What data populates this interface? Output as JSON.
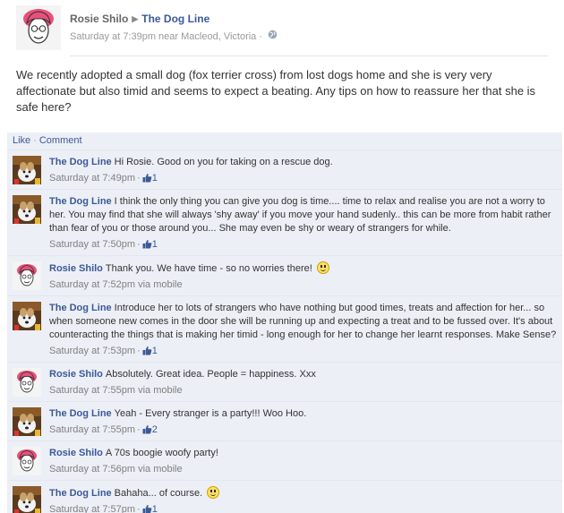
{
  "post": {
    "author": "Rosie Shilo",
    "target_page": "The Dog Line",
    "timestamp": "Saturday at 7:39pm near Macleod, Victoria",
    "privacy_icon": "globe-icon",
    "body": "We recently adopted a small dog (fox terrier cross) from lost dogs home and she is very very affectionate but also timid and seems to expect a beating. Any tips on how to reassure her that she is safe here?"
  },
  "actions": {
    "like": "Like",
    "separator": "·",
    "comment": "Comment"
  },
  "comments": [
    {
      "author": "The Dog Line",
      "type": "page",
      "text": "Hi Rosie. Good on you for taking on a rescue dog.",
      "time": "Saturday at 7:49pm",
      "via": "",
      "likes": "1",
      "emoticon": false
    },
    {
      "author": "The Dog Line",
      "type": "page",
      "text": "I think the only thing you can give you dog is time.... time to relax and realise you are not a worry to her. You may find that she will always 'shy away' if you move your hand sudenly.. this can be more from habit rather than fear of you or those around you... She may even be shy or weary of strangers for while.",
      "time": "Saturday at 7:50pm",
      "via": "",
      "likes": "1",
      "emoticon": false
    },
    {
      "author": "Rosie Shilo",
      "type": "user",
      "text": "Thank you. We have time - so no worries there!",
      "time": "Saturday at 7:52pm",
      "via": "via mobile",
      "likes": "",
      "emoticon": true
    },
    {
      "author": "The Dog Line",
      "type": "page",
      "text": "Introduce her to lots of strangers who have nothing but good times, treats and affection for her... so when someone new comes in the door she will be running up and expecting a treat and to be fussed over. It's about counteracting the things that is making her timid - long enough for her to change her learnt responses. Make Sense?",
      "time": "Saturday at 7:53pm",
      "via": "",
      "likes": "1",
      "emoticon": false
    },
    {
      "author": "Rosie Shilo",
      "type": "user",
      "text": "Absolutely. Great idea. People = happiness. Xxx",
      "time": "Saturday at 7:55pm",
      "via": "via mobile",
      "likes": "",
      "emoticon": false
    },
    {
      "author": "The Dog Line",
      "type": "page",
      "text": "Yeah - Every stranger is a party!!! Woo Hoo.",
      "time": "Saturday at 7:55pm",
      "via": "",
      "likes": "2",
      "emoticon": false
    },
    {
      "author": "Rosie Shilo",
      "type": "user",
      "text": "A 70s boogie woofy party!",
      "time": "Saturday at 7:56pm",
      "via": "via mobile",
      "likes": "",
      "emoticon": false
    },
    {
      "author": "The Dog Line",
      "type": "page",
      "text": "Bahaha... of course.",
      "time": "Saturday at 7:57pm",
      "via": "",
      "likes": "1",
      "emoticon": true
    }
  ],
  "colors": {
    "link": "#3b5998",
    "comment_bg": "#eceff5",
    "meta": "#808080"
  }
}
